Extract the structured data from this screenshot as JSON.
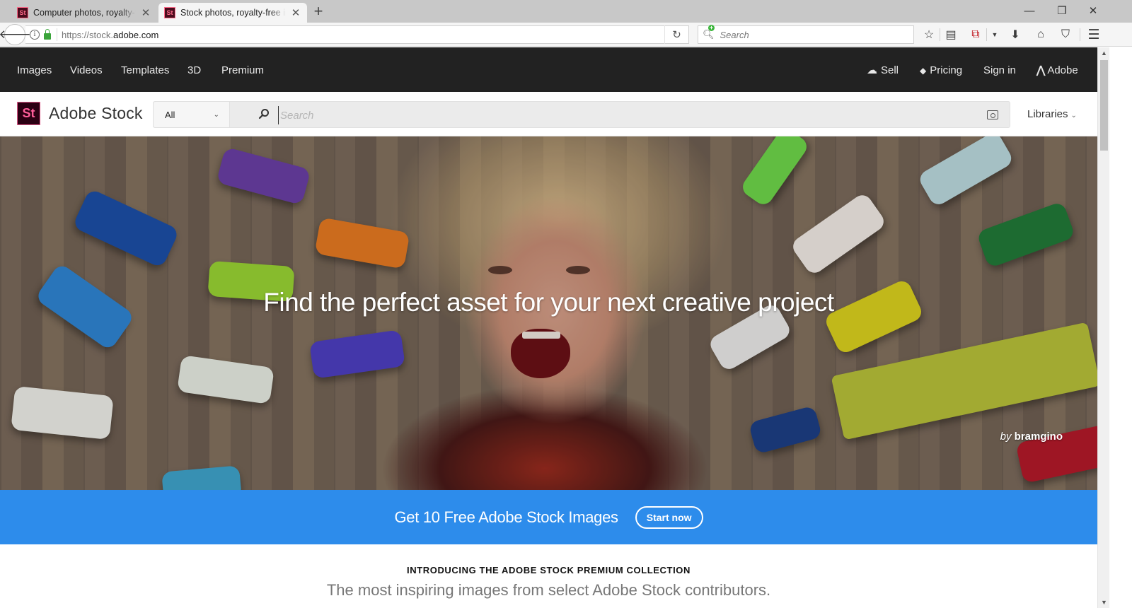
{
  "browser": {
    "tabs": [
      {
        "favicon": "St",
        "title": "Computer photos, royalty-free images",
        "active": false
      },
      {
        "favicon": "St",
        "title": "Stock photos, royalty-free images",
        "active": true
      }
    ],
    "new_tab_label": "+",
    "window_controls": {
      "minimize": "—",
      "restore": "❐",
      "close": "✕"
    },
    "url_protocol": "https://stock.",
    "url_host": "adobe.com",
    "search_placeholder": "Search",
    "toolbar_icons": [
      "bookmark-star-icon",
      "reading-list-icon",
      "pdf-icon",
      "dropdown-icon",
      "download-icon",
      "home-icon",
      "pocket-icon",
      "menu-icon"
    ]
  },
  "topnav": {
    "left": [
      "Images",
      "Videos",
      "Templates",
      "3D",
      "Premium"
    ],
    "sell": "Sell",
    "pricing": "Pricing",
    "signin": "Sign in",
    "adobe": "Adobe"
  },
  "subheader": {
    "logo_badge": "St",
    "logo_name": "Adobe Stock",
    "category": "All",
    "search_placeholder": "Search",
    "libraries": "Libraries"
  },
  "hero": {
    "headline": "Find the perfect asset for your next creative project",
    "credit_prefix": "by",
    "credit_author": "bramgino"
  },
  "promo": {
    "text": "Get 10 Free Adobe Stock Images",
    "button": "Start now",
    "color": "#2d8ceb"
  },
  "premium": {
    "kicker": "INTRODUCING THE ADOBE STOCK PREMIUM COLLECTION",
    "subtitle": "The most inspiring images from select Adobe Stock contributors."
  }
}
